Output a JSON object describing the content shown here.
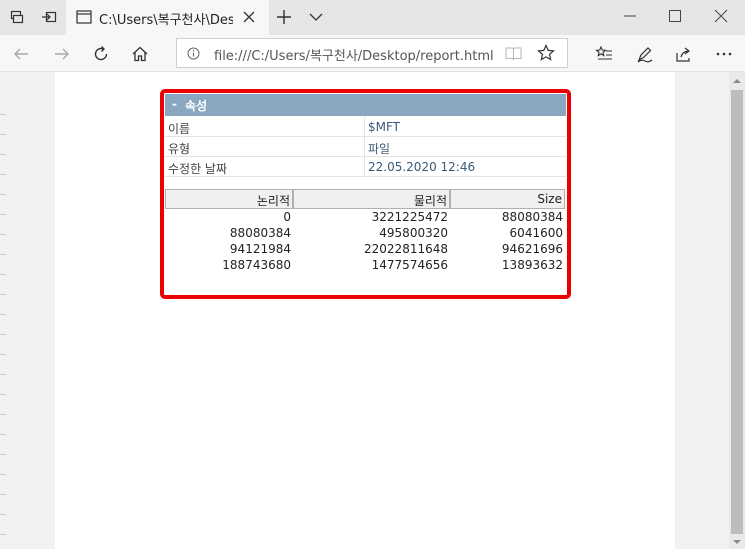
{
  "browser": {
    "tab_title": "C:\\Users\\복구천사\\Desk",
    "url": "file:///C:/Users/복구천사/Desktop/report.html"
  },
  "properties": {
    "header_toggle": "-",
    "header_title": "속성",
    "rows": [
      {
        "key": "이름",
        "value": "$MFT"
      },
      {
        "key": "유형",
        "value": "파일"
      },
      {
        "key": "수정한 날짜",
        "value": "22.05.2020 12:46"
      }
    ]
  },
  "runs_table": {
    "columns": [
      "논리적",
      "물리적",
      "Size"
    ],
    "rows": [
      [
        "0",
        "3221225472",
        "88080384"
      ],
      [
        "88080384",
        "495800320",
        "6041600"
      ],
      [
        "94121984",
        "22022811648",
        "94621696"
      ],
      [
        "188743680",
        "1477574656",
        "13893632"
      ]
    ]
  },
  "accent_color": "#ea0000",
  "header_color": "#8aa7c2"
}
